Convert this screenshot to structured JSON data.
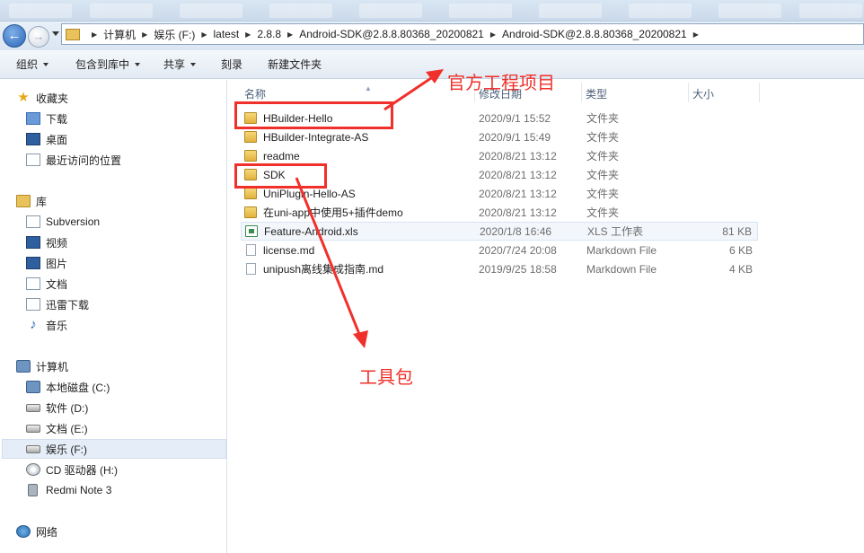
{
  "address_bar": {
    "crumbs": [
      "计算机",
      "娱乐 (F:)",
      "latest",
      "2.8.8",
      "Android-SDK@2.8.8.80368_20200821",
      "Android-SDK@2.8.8.80368_20200821"
    ]
  },
  "toolbar": {
    "organize": "组织",
    "include_in_library": "包含到库中",
    "share": "共享",
    "burn": "刻录",
    "new_folder": "新建文件夹"
  },
  "nav": {
    "favorites": {
      "label": "收藏夹",
      "items": [
        "下载",
        "桌面",
        "最近访问的位置"
      ]
    },
    "libraries": {
      "label": "库",
      "items": [
        "Subversion",
        "视频",
        "图片",
        "文档",
        "迅雷下载",
        "音乐"
      ]
    },
    "computer": {
      "label": "计算机",
      "items": [
        "本地磁盘 (C:)",
        "软件 (D:)",
        "文档 (E:)",
        "娱乐 (F:)",
        "CD 驱动器 (H:)",
        "Redmi Note 3"
      ],
      "selected": "娱乐 (F:)"
    },
    "network": {
      "label": "网络"
    }
  },
  "columns": {
    "name": "名称",
    "modified": "修改日期",
    "type": "类型",
    "size": "大小"
  },
  "files": [
    {
      "name": "HBuilder-Hello",
      "modified": "2020/9/1 15:52",
      "type": "文件夹",
      "size": "",
      "icon": "folder-icon"
    },
    {
      "name": "HBuilder-Integrate-AS",
      "modified": "2020/9/1 15:49",
      "type": "文件夹",
      "size": "",
      "icon": "folder-icon"
    },
    {
      "name": "readme",
      "modified": "2020/8/21 13:12",
      "type": "文件夹",
      "size": "",
      "icon": "folder-icon"
    },
    {
      "name": "SDK",
      "modified": "2020/8/21 13:12",
      "type": "文件夹",
      "size": "",
      "icon": "folder-icon"
    },
    {
      "name": "UniPlugin-Hello-AS",
      "modified": "2020/8/21 13:12",
      "type": "文件夹",
      "size": "",
      "icon": "folder-icon"
    },
    {
      "name": "在uni-app中使用5+插件demo",
      "modified": "2020/8/21 13:12",
      "type": "文件夹",
      "size": "",
      "icon": "folder-icon"
    },
    {
      "name": "Feature-Android.xls",
      "modified": "2020/1/8 16:46",
      "type": "XLS 工作表",
      "size": "81 KB",
      "icon": "xls-file-icon"
    },
    {
      "name": "license.md",
      "modified": "2020/7/24 20:08",
      "type": "Markdown File",
      "size": "6 KB",
      "icon": "markdown-file-icon"
    },
    {
      "name": "unipush离线集成指南.md",
      "modified": "2019/9/25 18:58",
      "type": "Markdown File",
      "size": "4 KB",
      "icon": "markdown-file-icon"
    }
  ],
  "annotations": {
    "official_project": "官方工程项目",
    "toolkit": "工具包",
    "color": "#f0302a"
  }
}
